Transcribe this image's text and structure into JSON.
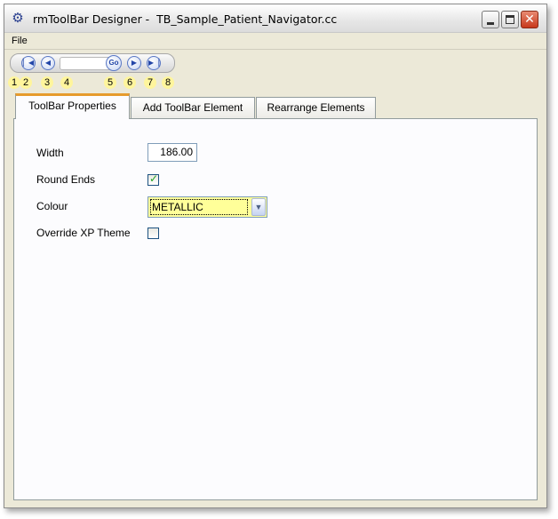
{
  "window": {
    "title": "rmToolBar Designer -  TB_Sample_Patient_Navigator.cc",
    "icon": "gear-icon",
    "controls": [
      "minimize-icon",
      "maximize-icon",
      "close-icon"
    ]
  },
  "menu": {
    "file_label": "File"
  },
  "toolbar": {
    "go_label": "Go",
    "input_value": "",
    "badges": [
      "1",
      "2",
      "3",
      "4",
      "5",
      "6",
      "7",
      "8"
    ],
    "icons": [
      "first-icon",
      "previous-icon",
      "next-icon",
      "last-icon"
    ]
  },
  "tabs": [
    {
      "label": "ToolBar Properties",
      "active": true
    },
    {
      "label": "Add ToolBar Element",
      "active": false
    },
    {
      "label": "Rearrange Elements",
      "active": false
    }
  ],
  "properties": {
    "width_label": "Width",
    "width_value": "186.00",
    "round_ends_label": "Round Ends",
    "round_ends_checked": true,
    "colour_label": "Colour",
    "colour_value": "METALLIC",
    "override_label": "Override XP Theme",
    "override_checked": false
  },
  "colors": {
    "active_tab_accent": "#e69b2c",
    "select_highlight": "#ffff99",
    "badge": "#fff59c",
    "check": "#21a121"
  }
}
